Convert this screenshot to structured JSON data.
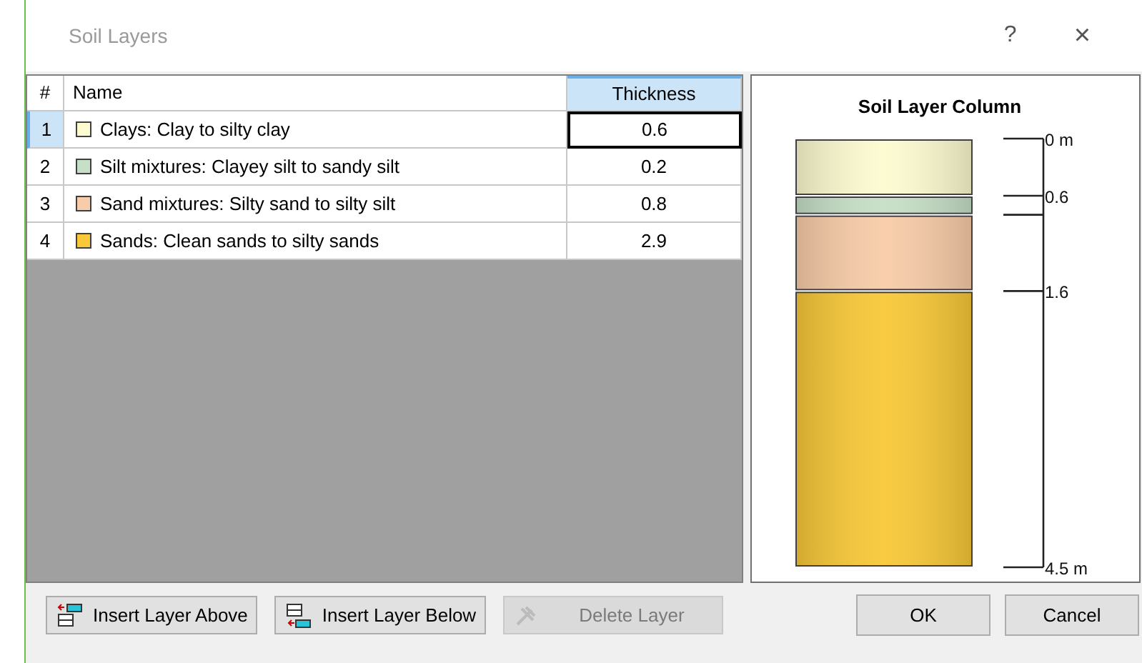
{
  "window": {
    "title": "Soil Layers",
    "help": "?",
    "close": "×"
  },
  "table": {
    "columns": [
      {
        "label": "#",
        "selected": false
      },
      {
        "label": "Name",
        "selected": false
      },
      {
        "label": "Thickness",
        "selected": true
      }
    ],
    "rows": [
      {
        "index": "1",
        "name": "Clays: Clay to silty clay",
        "thickness": "0.6",
        "color": "#fdfbd0",
        "selected": true
      },
      {
        "index": "2",
        "name": "Silt mixtures: Clayey silt to sandy silt",
        "thickness": "0.2",
        "color": "#c6dfc6",
        "selected": false
      },
      {
        "index": "3",
        "name": "Sand mixtures: Silty sand to silty silt",
        "thickness": "0.8",
        "color": "#f8cca8",
        "selected": false
      },
      {
        "index": "4",
        "name": "Sands: Clean sands to silty sands",
        "thickness": "2.9",
        "color": "#f8c838",
        "selected": false
      }
    ]
  },
  "column_chart": {
    "title": "Soil Layer Column",
    "scale_labels": [
      "0 m",
      "0.6",
      "1.6",
      "4.5 m"
    ]
  },
  "buttons": [
    {
      "kind": "insert-above",
      "label": "Insert Layer Above",
      "disabled": false
    },
    {
      "kind": "insert-below",
      "label": "Insert Layer Below",
      "disabled": false
    },
    {
      "kind": "delete",
      "label": "Delete Layer",
      "disabled": true
    }
  ],
  "dialog_buttons": [
    "OK",
    "Cancel"
  ]
}
